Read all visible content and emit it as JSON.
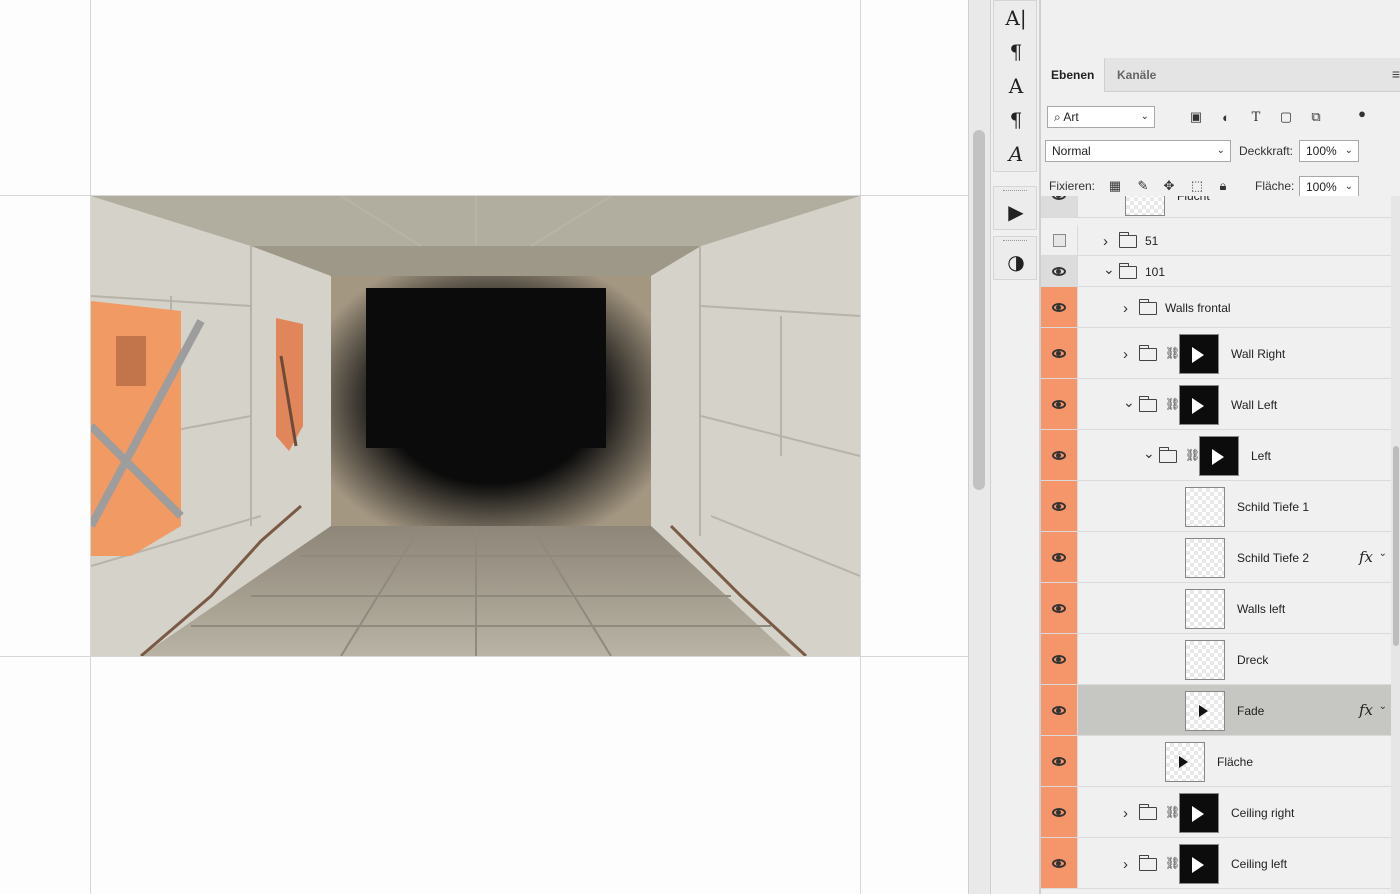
{
  "tools": {
    "items": [
      {
        "name": "text-tool-icon",
        "glyph": "A|"
      },
      {
        "name": "paragraph-icon",
        "glyph": "¶"
      },
      {
        "name": "character-styles-icon",
        "glyph": "A"
      },
      {
        "name": "paragraph-styles-icon",
        "glyph": "¶"
      },
      {
        "name": "glyphs-icon",
        "glyph": "A"
      }
    ],
    "play_glyph": "▶",
    "adjust_glyph": "◑"
  },
  "panel": {
    "tabs": [
      "Ebenen",
      "Kanäle"
    ],
    "menu_glyph": "≡",
    "filter_label": "Art",
    "blend_mode": "Normal",
    "opacity_label": "Deckkraft:",
    "opacity_value": "100%",
    "lock_label": "Fixieren:",
    "fill_label": "Fläche:",
    "fill_value": "100%"
  },
  "layers": [
    {
      "name": "Flucht",
      "eye": "gray",
      "indent": 0,
      "type": "layer",
      "partial": true
    },
    {
      "name": "51",
      "eye": "empty",
      "indent": 0,
      "type": "group-collapsed"
    },
    {
      "name": "101",
      "eye": "gray",
      "indent": 0,
      "type": "group-open"
    },
    {
      "name": "Walls frontal",
      "eye": "orange",
      "indent": 1,
      "type": "group-collapsed"
    },
    {
      "name": "Wall  Right",
      "eye": "orange",
      "indent": 1,
      "type": "group-collapsed-mask"
    },
    {
      "name": "Wall  Left",
      "eye": "orange",
      "indent": 1,
      "type": "group-open-mask"
    },
    {
      "name": "Left",
      "eye": "orange",
      "indent": 2,
      "type": "group-open-mask"
    },
    {
      "name": "Schild Tiefe 1",
      "eye": "orange",
      "indent": 3,
      "type": "layer"
    },
    {
      "name": "Schild Tiefe 2",
      "eye": "orange",
      "indent": 3,
      "type": "layer",
      "fx": true
    },
    {
      "name": "Walls left",
      "eye": "orange",
      "indent": 3,
      "type": "layer"
    },
    {
      "name": "Dreck",
      "eye": "orange",
      "indent": 3,
      "type": "layer"
    },
    {
      "name": "Fade",
      "eye": "orange",
      "indent": 3,
      "type": "layer",
      "fx": true,
      "selected": true
    },
    {
      "name": "Fläche",
      "eye": "orange",
      "indent": 2,
      "type": "layer"
    },
    {
      "name": "Ceiling right",
      "eye": "orange",
      "indent": 1,
      "type": "group-collapsed-mask"
    },
    {
      "name": "Ceiling left",
      "eye": "orange",
      "indent": 1,
      "type": "group-collapsed-mask"
    }
  ],
  "fx_label": "fx",
  "colors": {
    "visibility_highlight": "#f5956a",
    "selected_row": "#c6c6c2",
    "wall": "#d6d3cb",
    "floor": "#b3ae9f",
    "void": "#0b0b0b"
  }
}
